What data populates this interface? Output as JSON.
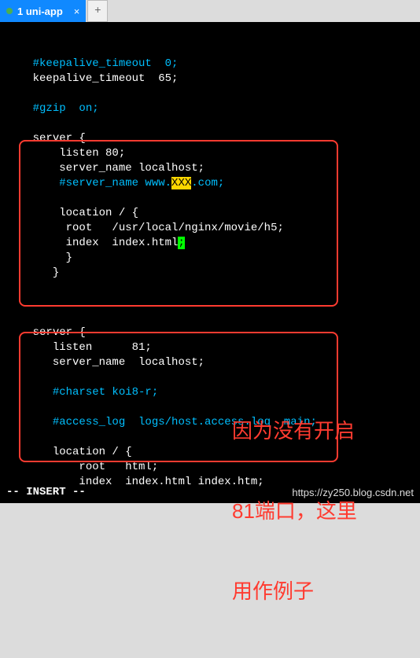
{
  "tab": {
    "title": "1 uni-app",
    "close_glyph": "×",
    "new_tab_glyph": "+"
  },
  "code": {
    "l1_comment": "#keepalive_timeout  0;",
    "l2": "keepalive_timeout  65;",
    "l3_comment": "#gzip  on;",
    "l4": "server {",
    "l5": "listen 80;",
    "l6": "server_name localhost;",
    "l7_comment_a": "#server_name www.",
    "l7_hl": "XXX",
    "l7_comment_b": ".com;",
    "l8": "location / {",
    "l9": " root   /usr/local/nginx/movie/h5;",
    "l10a": " index  index.html",
    "l10_cursor": ";",
    "l11": " }",
    "l12": "}",
    "s2_1": "server {",
    "s2_2": "listen      81;",
    "s2_3": "server_name  localhost;",
    "s2_4_comment": "#charset koi8-r;",
    "s2_5_comment": "#access_log  logs/host.access.log  main;",
    "s2_6": "location / {",
    "s2_7": "root   html;",
    "s2_8": "index  index.html index.htm;"
  },
  "annotation": {
    "line1": "因为没有开启",
    "line2": "81端口，这里",
    "line3": "用作例子"
  },
  "status_text": "-- INSERT --",
  "watermark": "https://zy250.blog.csdn.net"
}
